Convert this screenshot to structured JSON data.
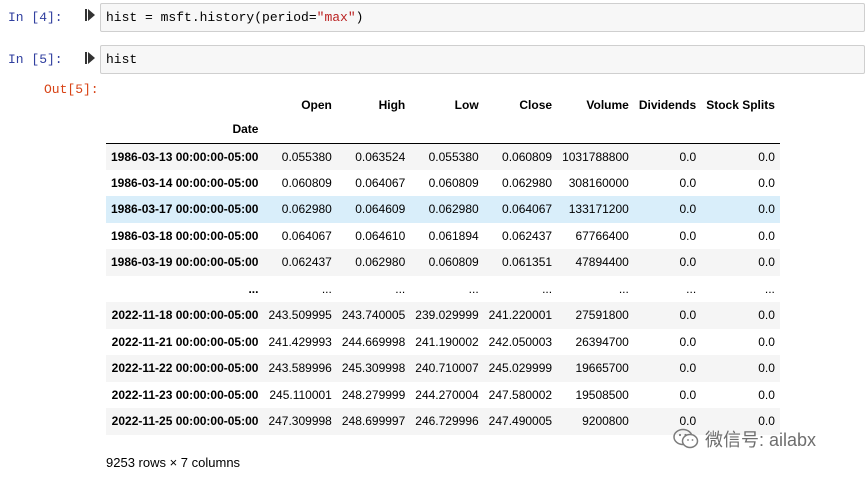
{
  "cells": [
    {
      "prompt": "In  [4]:",
      "code_parts": {
        "pre": "hist = msft.history(period=",
        "str": "\"max\"",
        "post": ")"
      }
    },
    {
      "prompt": "In  [5]:",
      "code": "hist",
      "out_prompt": "Out[5]:"
    }
  ],
  "dataframe": {
    "columns": [
      "Open",
      "High",
      "Low",
      "Close",
      "Volume",
      "Dividends",
      "Stock Splits"
    ],
    "index_name": "Date",
    "rows": [
      {
        "index": "1986-03-13 00:00:00-05:00",
        "values": [
          "0.055380",
          "0.063524",
          "0.055380",
          "0.060809",
          "1031788800",
          "0.0",
          "0.0"
        ]
      },
      {
        "index": "1986-03-14 00:00:00-05:00",
        "values": [
          "0.060809",
          "0.064067",
          "0.060809",
          "0.062980",
          "308160000",
          "0.0",
          "0.0"
        ]
      },
      {
        "index": "1986-03-17 00:00:00-05:00",
        "values": [
          "0.062980",
          "0.064609",
          "0.062980",
          "0.064067",
          "133171200",
          "0.0",
          "0.0"
        ]
      },
      {
        "index": "1986-03-18 00:00:00-05:00",
        "values": [
          "0.064067",
          "0.064610",
          "0.061894",
          "0.062437",
          "67766400",
          "0.0",
          "0.0"
        ]
      },
      {
        "index": "1986-03-19 00:00:00-05:00",
        "values": [
          "0.062437",
          "0.062980",
          "0.060809",
          "0.061351",
          "47894400",
          "0.0",
          "0.0"
        ]
      },
      {
        "index": "...",
        "values": [
          "...",
          "...",
          "...",
          "...",
          "...",
          "...",
          "..."
        ]
      },
      {
        "index": "2022-11-18 00:00:00-05:00",
        "values": [
          "243.509995",
          "243.740005",
          "239.029999",
          "241.220001",
          "27591800",
          "0.0",
          "0.0"
        ]
      },
      {
        "index": "2022-11-21 00:00:00-05:00",
        "values": [
          "241.429993",
          "244.669998",
          "241.190002",
          "242.050003",
          "26394700",
          "0.0",
          "0.0"
        ]
      },
      {
        "index": "2022-11-22 00:00:00-05:00",
        "values": [
          "243.589996",
          "245.309998",
          "240.710007",
          "245.029999",
          "19665700",
          "0.0",
          "0.0"
        ]
      },
      {
        "index": "2022-11-23 00:00:00-05:00",
        "values": [
          "245.110001",
          "248.279999",
          "244.270004",
          "247.580002",
          "19508500",
          "0.0",
          "0.0"
        ]
      },
      {
        "index": "2022-11-25 00:00:00-05:00",
        "values": [
          "247.309998",
          "248.699997",
          "246.729996",
          "247.490005",
          "9200800",
          "0.0",
          "0.0"
        ]
      }
    ],
    "hover_row": 2,
    "summary": "9253 rows × 7 columns"
  },
  "watermark": {
    "text": "微信号: ailabx",
    "icon": "wechat-icon"
  },
  "colors": {
    "in_prompt": "#303f9f",
    "out_prompt": "#d84315",
    "string": "#ba2121",
    "hover_row": "#d9eefa"
  }
}
